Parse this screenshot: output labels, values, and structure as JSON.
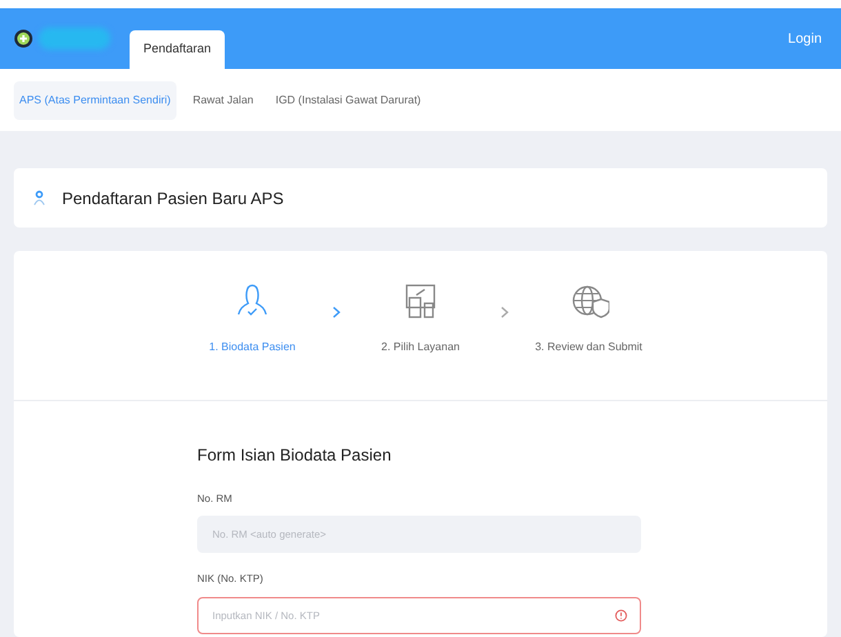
{
  "navbar": {
    "tabs": [
      {
        "label": "Pendaftaran",
        "selected": true
      }
    ],
    "login": "Login"
  },
  "subnav": [
    {
      "label": "APS (Atas Permintaan Sendiri)",
      "selected": true
    },
    {
      "label": "Rawat Jalan",
      "selected": false
    },
    {
      "label": "IGD (Instalasi Gawat Darurat)",
      "selected": false
    }
  ],
  "page_title": "Pendaftaran Pasien Baru APS",
  "steps": [
    {
      "kind": "person",
      "label": "1. Biodata Pasien",
      "selected": true
    },
    {
      "kind": "devices",
      "label": "2. Pilih Layanan",
      "selected": false
    },
    {
      "kind": "globe",
      "label": "3. Review dan Submit",
      "selected": false
    }
  ],
  "form": {
    "title": "Form Isian Biodata Pasien",
    "fields": [
      {
        "label": "No. RM",
        "placeholder": "No. RM <auto generate>",
        "disabled": true,
        "invalid": false
      },
      {
        "label": "NIK (No. KTP)",
        "placeholder": "Inputkan NIK / No. KTP",
        "disabled": false,
        "invalid": true
      }
    ]
  }
}
